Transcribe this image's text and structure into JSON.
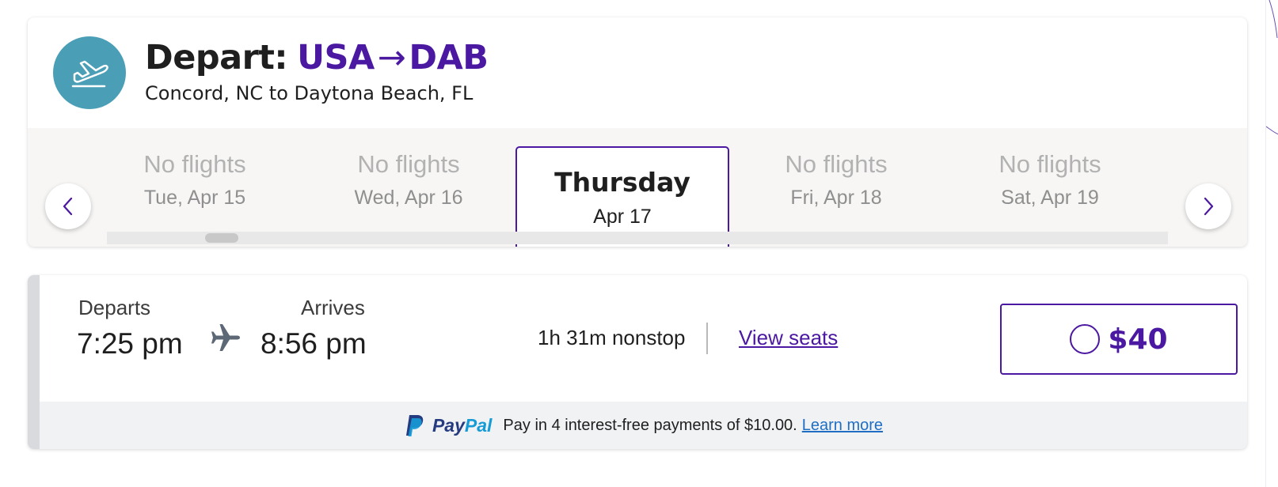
{
  "header": {
    "depart_word": "Depart:",
    "origin_code": "USA",
    "arrow": "→",
    "destination_code": "DAB",
    "subtitle": "Concord, NC to Daytona Beach, FL",
    "icon": "airplane-takeoff-icon"
  },
  "date_strip": {
    "prev_icon": "chevron-left-icon",
    "next_icon": "chevron-right-icon",
    "dates": [
      {
        "top": "No flights",
        "bottom": "Tue, Apr 15",
        "selected": false
      },
      {
        "top": "No flights",
        "bottom": "Wed, Apr 16",
        "selected": false
      },
      {
        "top": "Thursday",
        "bottom": "Apr 17",
        "selected": true
      },
      {
        "top": "No flights",
        "bottom": "Fri, Apr 18",
        "selected": false
      },
      {
        "top": "No flights",
        "bottom": "Sat, Apr 19",
        "selected": false
      }
    ]
  },
  "flight": {
    "departs_label": "Departs",
    "departs_time": "7:25 pm",
    "arrives_label": "Arrives",
    "arrives_time": "8:56 pm",
    "duration": "1h 31m nonstop",
    "view_seats": "View seats",
    "price": "$40",
    "plane_icon": "airplane-icon"
  },
  "paypal": {
    "brand_part1": "Pay",
    "brand_part2": "Pal",
    "message": "Pay in 4 interest-free payments of $10.00.",
    "learn_more": "Learn more"
  },
  "colors": {
    "accent": "#4b18a1",
    "icon_circle": "#4a9fb7",
    "paypal_dark": "#253b80",
    "paypal_light": "#179bd7"
  }
}
